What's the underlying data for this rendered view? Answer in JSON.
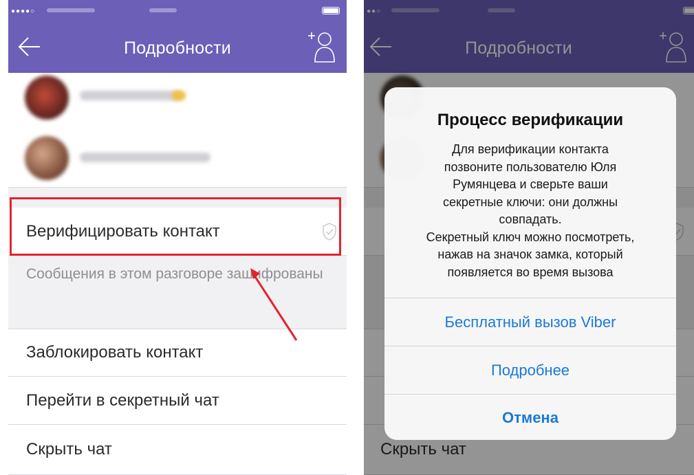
{
  "header": {
    "title": "Подробности"
  },
  "left": {
    "menu": {
      "verify": "Верифицировать контакт",
      "encrypted_hint": "Сообщения в этом разговоре зашифрованы",
      "block": "Заблокировать контакт",
      "secret_chat": "Перейти в секретный чат",
      "hide_chat": "Скрыть чат"
    }
  },
  "right": {
    "dialog": {
      "title": "Процесс верификации",
      "message": "Для верификации контакта\nпозвоните пользователю Юля\nРумянцева  и сверьте ваши\nсекретные ключи: они должны\nсовпадать.\nСекретный ключ можно посмотреть,\nнажав на значок замка, который\nпоявляется во время вызова",
      "buttons": {
        "free_call": "Бесплатный вызов Viber",
        "more": "Подробнее",
        "cancel": "Отмена"
      }
    },
    "background": {
      "hide_chat": "Скрыть чат"
    }
  },
  "colors": {
    "header": "#6c5fb8",
    "highlight": "#e3232d",
    "link": "#1a7ad4"
  },
  "icons": {
    "back": "arrow-left-icon",
    "add_user": "add-participant-icon",
    "shield": "shield-check-icon"
  }
}
